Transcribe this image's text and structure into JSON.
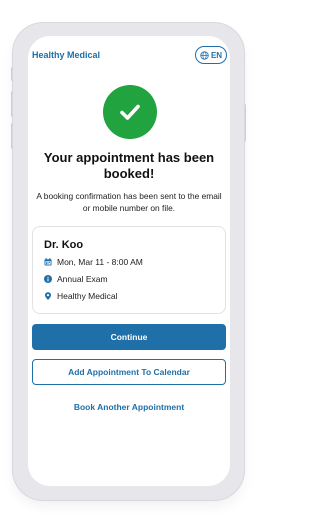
{
  "header": {
    "brand": "Healthy Medical",
    "language": "EN"
  },
  "confirmation": {
    "title": "Your appointment has been booked!",
    "message": "A booking confirmation has been sent to the email or mobile number on file."
  },
  "appointment": {
    "doctor": "Dr. Koo",
    "datetime": "Mon, Mar 11 - 8:00 AM",
    "type": "Annual Exam",
    "location": "Healthy Medical"
  },
  "actions": {
    "continue": "Continue",
    "add_to_calendar": "Add Appointment To Calendar",
    "book_another": "Book Another Appointment"
  },
  "colors": {
    "primary": "#1f6fa8",
    "success": "#21a340"
  }
}
